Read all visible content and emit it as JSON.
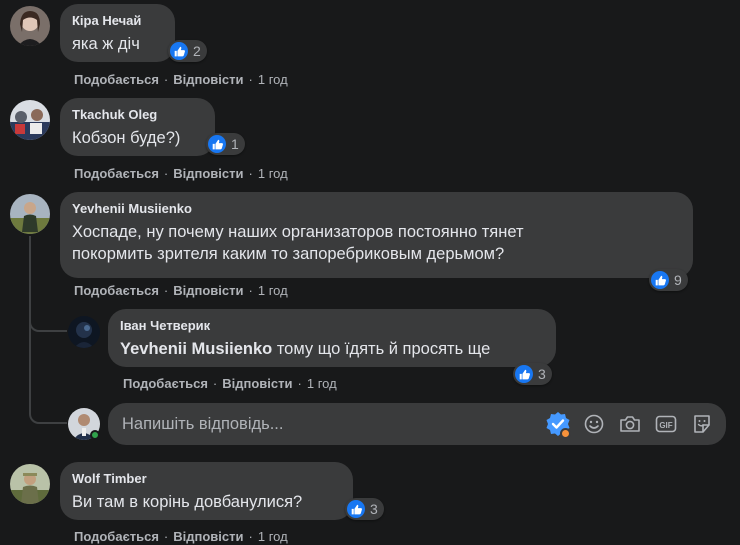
{
  "labels": {
    "like": "Подобається",
    "reply": "Відповісти",
    "sep": "·"
  },
  "comments": [
    {
      "author": "Кіра Нечай",
      "text": "яка ж діч",
      "reactions": "2",
      "time": "1 год"
    },
    {
      "author": "Tkachuk Oleg",
      "text": "Кобзон буде?)",
      "reactions": "1",
      "time": "1 год"
    },
    {
      "author": "Yevhenii Musiienko",
      "text_line1": "Хоспаде, ну почему наших организаторов постоянно тянет",
      "text_line2": "покормить зрителя каким то запоребриковым дерьмом?",
      "reactions": "9",
      "time": "1 год"
    },
    {
      "author": "Іван Четверик",
      "mention": "Yevhenii Musiienko",
      "text": "тому що їдять й просять ще",
      "reactions": "3",
      "time": "1 год"
    },
    {
      "author": "Wolf Timber",
      "text": "Ви там в корінь довбанулися?",
      "reactions": "3",
      "time": "1 год"
    }
  ],
  "reply_box": {
    "placeholder": "Напишіть відповідь..."
  },
  "colors": {
    "background": "#18191a",
    "bubble": "#3a3b3c",
    "like_blue": "#1877f2",
    "muted_text": "#b0b3b8"
  },
  "icons": [
    "like-icon",
    "emoji-icon",
    "camera-icon",
    "gif-icon",
    "sticker-icon",
    "avatar-frame-icon"
  ]
}
